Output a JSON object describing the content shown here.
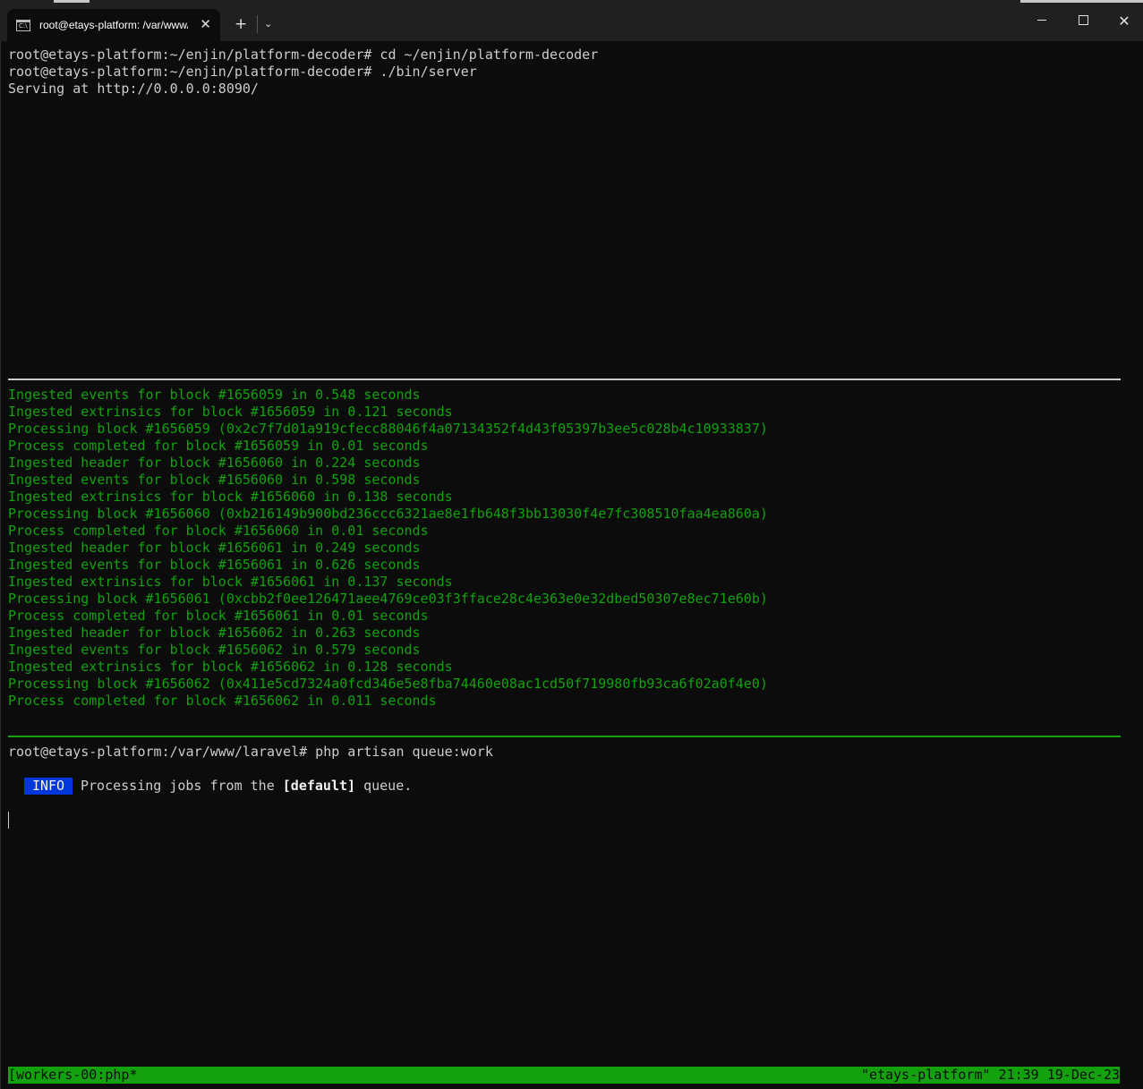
{
  "window": {
    "tab_title": "root@etays-platform: /var/www/laravel",
    "tab_icon_glyph": "C:\\",
    "close_glyph": "✕",
    "new_tab_glyph": "+",
    "dropdown_glyph": "⌄",
    "maximize_glyph": "",
    "close_window_glyph": "✕"
  },
  "pane1": {
    "lines": [
      "root@etays-platform:~/enjin/platform-decoder# cd ~/enjin/platform-decoder",
      "root@etays-platform:~/enjin/platform-decoder# ./bin/server",
      "Serving at http://0.0.0.0:8090/"
    ]
  },
  "pane2": {
    "lines": [
      "Ingested events for block #1656059 in 0.548 seconds",
      "Ingested extrinsics for block #1656059 in 0.121 seconds",
      "Processing block #1656059 (0x2c7f7d01a919cfecc88046f4a07134352f4d43f05397b3ee5c028b4c10933837)",
      "Process completed for block #1656059 in 0.01 seconds",
      "Ingested header for block #1656060 in 0.224 seconds",
      "Ingested events for block #1656060 in 0.598 seconds",
      "Ingested extrinsics for block #1656060 in 0.138 seconds",
      "Processing block #1656060 (0xb216149b900bd236ccc6321ae8e1fb648f3bb13030f4e7fc308510faa4ea860a)",
      "Process completed for block #1656060 in 0.01 seconds",
      "Ingested header for block #1656061 in 0.249 seconds",
      "Ingested events for block #1656061 in 0.626 seconds",
      "Ingested extrinsics for block #1656061 in 0.137 seconds",
      "Processing block #1656061 (0xcbb2f0ee126471aee4769ce03f3fface28c4e363e0e32dbed50307e8ec71e60b)",
      "Process completed for block #1656061 in 0.01 seconds",
      "Ingested header for block #1656062 in 0.263 seconds",
      "Ingested events for block #1656062 in 0.579 seconds",
      "Ingested extrinsics for block #1656062 in 0.128 seconds",
      "Processing block #1656062 (0x411e5cd7324a0fcd346e5e8fba74460e08ac1cd50f719980fb93ca6f02a0f4e0)",
      "Process completed for block #1656062 in 0.011 seconds"
    ]
  },
  "pane3": {
    "prompt": "root@etays-platform:/var/www/laravel# php artisan queue:work",
    "info_badge": "INFO",
    "info_prefix": "Processing jobs from the ",
    "info_queue": "[default]",
    "info_suffix": " queue."
  },
  "status_bar": {
    "left": "[workers-00:php*",
    "right": "\"etays-platform\" 21:39 19-Dec-23"
  },
  "colors": {
    "background": "#0c0c0c",
    "terminal_green": "#13a10e",
    "info_blue": "#0037da",
    "titlebar": "#202020"
  }
}
